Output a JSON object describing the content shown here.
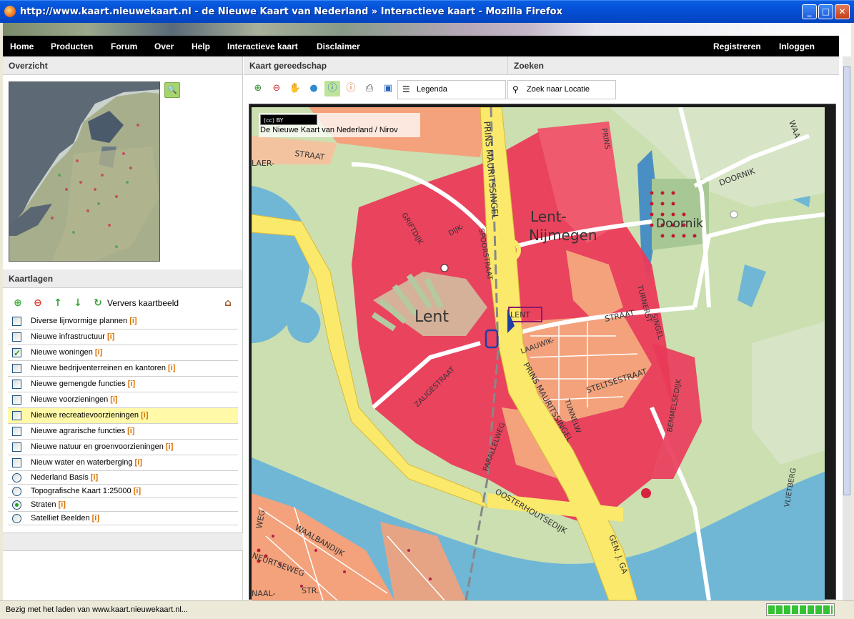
{
  "window": {
    "title": "http://www.kaart.nieuwekaart.nl - de Nieuwe Kaart van Nederland » Interactieve kaart - Mozilla Firefox",
    "minimize": "_",
    "maximize": "□",
    "close": "✕"
  },
  "nav": {
    "items": [
      "Home",
      "Producten",
      "Forum",
      "Over",
      "Help",
      "Interactieve kaart",
      "Disclaimer"
    ],
    "right": [
      "Registreren",
      "Inloggen"
    ]
  },
  "panels": {
    "overview": "Overzicht",
    "tools": "Kaart gereedschap",
    "search": "Zoeken",
    "layers": "Kaartlagen"
  },
  "layer_tools": {
    "refresh": "Ververs kaartbeeld"
  },
  "layers": [
    {
      "label": "Diverse lijnvormige plannen",
      "info": "[i]",
      "type": "checkbox",
      "checked": false,
      "highlight": false
    },
    {
      "label": "Nieuwe infrastructuur",
      "info": "[i]",
      "type": "checkbox",
      "checked": false,
      "highlight": false
    },
    {
      "label": "Nieuwe woningen",
      "info": "[i]",
      "type": "checkbox",
      "checked": true,
      "highlight": false
    },
    {
      "label": "Nieuwe bedrijventerreinen en kantoren",
      "info": "[i]",
      "type": "checkbox",
      "checked": false,
      "highlight": false
    },
    {
      "label": "Nieuwe gemengde functies",
      "info": "[i]",
      "type": "checkbox",
      "checked": false,
      "highlight": false
    },
    {
      "label": "Nieuwe voorzieningen",
      "info": "[i]",
      "type": "checkbox",
      "checked": false,
      "highlight": false
    },
    {
      "label": "Nieuwe recreatievoorzieningen",
      "info": "[i]",
      "type": "checkbox",
      "checked": false,
      "highlight": true
    },
    {
      "label": "Nieuwe agrarische functies",
      "info": "[i]",
      "type": "checkbox",
      "checked": false,
      "highlight": false
    },
    {
      "label": "Nieuwe natuur en groenvoorzieningen",
      "info": "[i]",
      "type": "checkbox",
      "checked": false,
      "highlight": false
    },
    {
      "label": "Nieuw water en waterberging",
      "info": "[i]",
      "type": "checkbox",
      "checked": false,
      "highlight": false
    },
    {
      "label": "Nederland Basis",
      "info": "[i]",
      "type": "radio",
      "checked": false,
      "highlight": false
    },
    {
      "label": "Topografische Kaart 1:25000",
      "info": "[i]",
      "type": "radio",
      "checked": false,
      "highlight": false
    },
    {
      "label": "Straten",
      "info": "[i]",
      "type": "radio",
      "checked": true,
      "highlight": false
    },
    {
      "label": "Satelliet Beelden",
      "info": "[i]",
      "type": "radio",
      "checked": false,
      "highlight": false
    }
  ],
  "toolbar": {
    "legend": "Legenda",
    "search_location": "Zoek naar Locatie"
  },
  "map": {
    "credit": "De Nieuwe Kaart van Nederland / Nirov",
    "cc_badge": "(cc) BY",
    "labels": {
      "lent": "Lent",
      "lent_nijmegen_1": "Lent-",
      "lent_nijmegen_2": "Nijmegen",
      "doornik": "Doornik",
      "doornik_road": "DOORNIK",
      "prins_mauritssingel": "PRINS MAURITSSINGEL",
      "prins_mauritssingel2": "PRINS MAURITSSINGEL",
      "griftdijk": "GRIFTDIJK",
      "dijk": "DIJK-",
      "spoorstraat": "SPOORSTRAAT",
      "straat": "STRAAT",
      "straat2": "STRAAT",
      "laer": "LAER-",
      "lauwik": "LAAUWIK-",
      "steltsestraat": "STELTSESTRAAT",
      "zaligestraat": "ZALIGESTRAAT",
      "parallelweg": "PARALLELWEG",
      "oosterhoutsedijk": "OOSTERHOUTSEDIJK",
      "bemmelsedijk": "BEMMELSEDIJK",
      "vlietberg": "VLIETBERG",
      "gen_j_ga": "GEN. J. GA",
      "turnerstraat": "TURNERST",
      "tunnel": "TUNNELW",
      "waalbandijk": "WAALBANDIJK",
      "neurtseweg": "NEURTSEWEG",
      "weg": "WEG",
      "naal": "NAAL-",
      "str": "STR.",
      "lent_marker": "LENT",
      "singel": "SINGEL",
      "waa": "WAA",
      "prins": "PRINS"
    }
  },
  "status": {
    "text": "Bezig met het laden van www.kaart.nieuwekaart.nl...",
    "progress": 1.0
  }
}
